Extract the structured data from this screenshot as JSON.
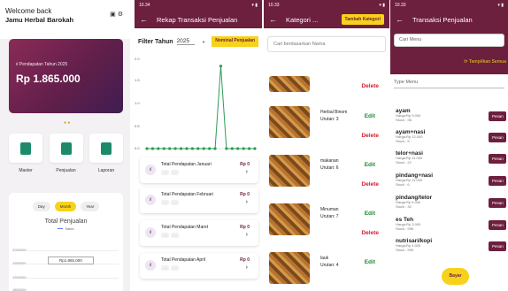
{
  "s1": {
    "welcome": "Welcome back",
    "store": "Jamu Herbal Barokah",
    "card_label": "Pendapatan Tahun 2025",
    "card_value": "Rp 1.865.000",
    "menu": [
      "Master",
      "Penjualan",
      "Laporan"
    ],
    "pills": [
      "Day",
      "Month",
      "Year"
    ],
    "active_pill": "Month",
    "chart_title": "Total Penjualan",
    "legend": "Sales",
    "bar_label": "Rp1.865.000",
    "y_ticks": [
      "2000000",
      "1950000",
      "1900000",
      "1850000"
    ]
  },
  "s2": {
    "time": "10.34",
    "title": "Rekap Transaksi Penjualan",
    "filter_label": "Filter Tahun",
    "year": "2025",
    "nominal_btn": "Nominal Penjualan",
    "chart_data": {
      "type": "line",
      "y_ticks": [
        "2.0",
        "1.5",
        "1.0",
        "0.5",
        "0.0"
      ],
      "ylim": [
        0,
        2.0
      ],
      "values": [
        0,
        0,
        0,
        0,
        0,
        0,
        0,
        0,
        0,
        0,
        0,
        0,
        0,
        1.865,
        0,
        0,
        0,
        0,
        0,
        0
      ]
    },
    "items": [
      {
        "title": "Total Pendapatan Januari",
        "amount": "Rp 0"
      },
      {
        "title": "Total Pendapatan Februari",
        "amount": "Rp 0"
      },
      {
        "title": "Total Pendapatan Maret",
        "amount": "Rp 0"
      },
      {
        "title": "Total Pendapatan April",
        "amount": "Rp 0"
      }
    ]
  },
  "s3": {
    "time": "10.33",
    "title": "Kategori ...",
    "tambah": "Tambah Kategori",
    "search_placeholder": "Cari berdasarkan Nama",
    "edit": "Edit",
    "delete": "Delete",
    "categories": [
      {
        "name": "Herbal Binom",
        "urutan": "Urutan: 3"
      },
      {
        "name": "makanan",
        "urutan": "Urutan: 6"
      },
      {
        "name": "Minuman",
        "urutan": "Urutan: 7"
      },
      {
        "name": "lauk",
        "urutan": "Urutan: 4"
      }
    ]
  },
  "s4": {
    "time": "10.33",
    "title": "Transaksi Penjualan",
    "cari": "Cari Menu",
    "tampilkan": "Tampilkan Semua",
    "type_menu": "Type Menu",
    "pesan": "Pesan",
    "bayar": "Bayar",
    "products": [
      {
        "name": "ayam",
        "price": "Harga:Rp 9.000",
        "stock": "Stock : 98"
      },
      {
        "name": "ayam+nasi",
        "price": "Harga:Rp 12.000",
        "stock": "Stock : 5"
      },
      {
        "name": "telor+nasi",
        "price": "Harga:Rp 11.000",
        "stock": "Stock : 22"
      },
      {
        "name": "pindang+nasi",
        "price": "Harga:Rp 11.000",
        "stock": "Stock : 6"
      },
      {
        "name": "pindang/telor",
        "price": "Harga:Rp 6.000",
        "stock": "Stock : 30"
      },
      {
        "name": "es Teh",
        "price": "Harga:Rp 3.000",
        "stock": "Stock : 998"
      },
      {
        "name": "nutrisari/kopi",
        "price": "Harga:Rp 4.000",
        "stock": "Stock : 999"
      }
    ]
  }
}
